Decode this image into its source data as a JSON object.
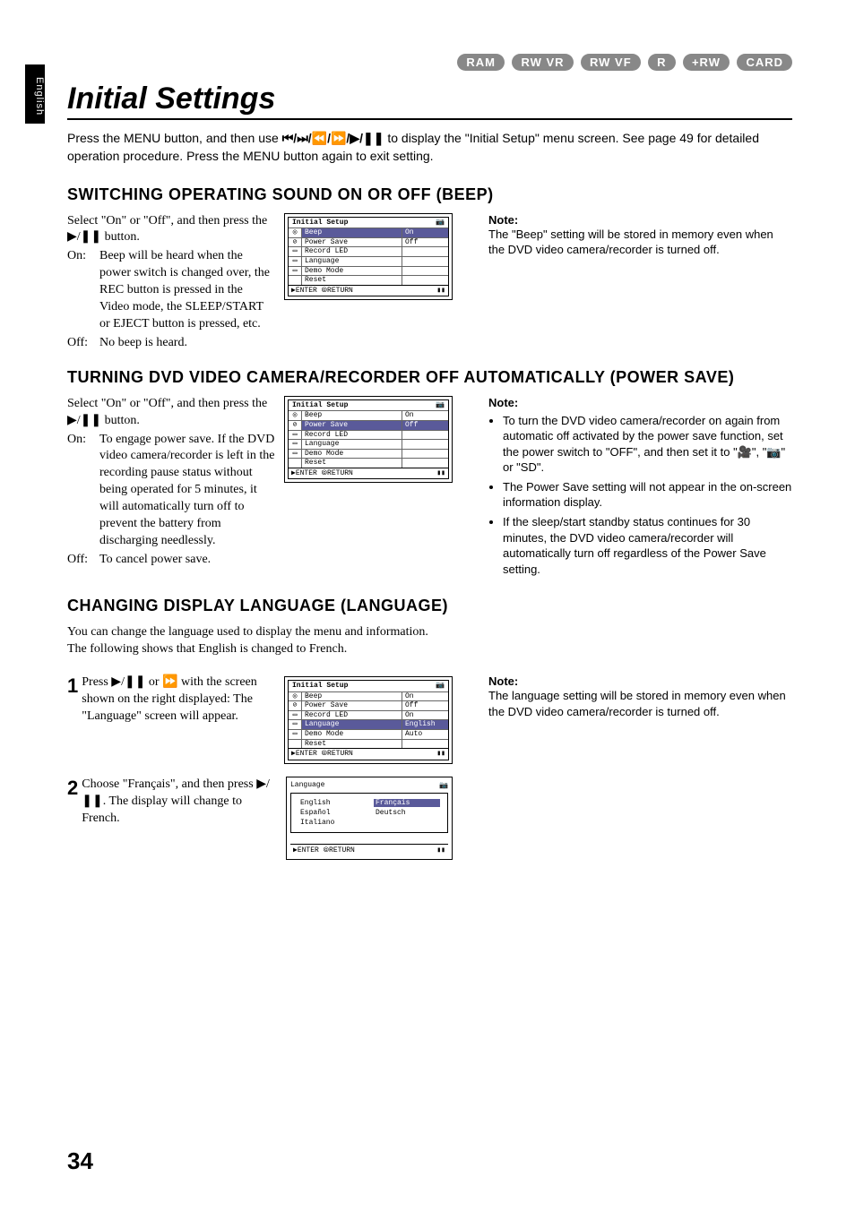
{
  "side_tab": "English",
  "badges": [
    "RAM",
    "RW VR",
    "RW VF",
    "R",
    "+RW",
    "CARD"
  ],
  "title": "Initial Settings",
  "intro_a": "Press the MENU button, and then use ",
  "intro_glyphs": "⏮/⏭/⏪/⏩/▶/❚❚",
  "intro_b": " to display the \"Initial Setup\" menu screen. See page 49 for detailed operation procedure. Press the MENU button again to exit setting.",
  "beep": {
    "heading": "SWITCHING OPERATING SOUND ON OR OFF (BEEP)",
    "select_line": "Select \"On\" or \"Off\", and then press the ▶/❚❚ button.",
    "on_label": "On:",
    "on_text": "Beep will be heard when the power switch is changed over, the REC button is pressed in the Video mode, the SLEEP/START or EJECT button is pressed, etc.",
    "off_label": "Off:",
    "off_text": "No beep is heard.",
    "note_head": "Note:",
    "note_text": "The \"Beep\" setting will be stored in memory even when the DVD video camera/recorder is turned off.",
    "osd": {
      "title": "Initial Setup",
      "rows": [
        {
          "label": "Beep",
          "val": "On",
          "hl": true,
          "valsel": true
        },
        {
          "label": "Power Save",
          "val": "Off"
        },
        {
          "label": "Record LED",
          "val": ""
        },
        {
          "label": "Language",
          "val": ""
        },
        {
          "label": "Demo Mode",
          "val": ""
        },
        {
          "label": "Reset",
          "val": ""
        }
      ],
      "foot_left": "ENTER",
      "foot_mid": "RETURN"
    }
  },
  "psave": {
    "heading": "TURNING DVD VIDEO CAMERA/RECORDER OFF AUTOMATICALLY (POWER SAVE)",
    "select_line": "Select \"On\" or \"Off\", and then press the ▶/❚❚ button.",
    "on_label": "On:",
    "on_text": "To engage power save. If the DVD video camera/recorder is left in the recording pause status without being operated for 5 minutes, it will automatically turn off to prevent the battery from discharging needlessly.",
    "off_label": "Off:",
    "off_text": "To cancel power save.",
    "note_head": "Note:",
    "notes": [
      "To turn the DVD video camera/recorder on again from automatic off activated by the power save function, set the power switch to \"OFF\", and then set it to \"🎥\", \"📷\" or \"SD\".",
      "The Power Save setting will not appear in the on-screen information display.",
      "If the sleep/start standby status continues for 30 minutes, the DVD video camera/recorder will automatically turn off regardless of the Power Save setting."
    ],
    "osd": {
      "title": "Initial Setup",
      "rows": [
        {
          "label": "Beep",
          "val": "On"
        },
        {
          "label": "Power Save",
          "val": "Off",
          "hl": true,
          "valsel": true
        },
        {
          "label": "Record LED",
          "val": ""
        },
        {
          "label": "Language",
          "val": ""
        },
        {
          "label": "Demo Mode",
          "val": ""
        },
        {
          "label": "Reset",
          "val": ""
        }
      ],
      "foot_left": "ENTER",
      "foot_mid": "RETURN"
    }
  },
  "lang": {
    "heading": "CHANGING DISPLAY LANGUAGE (LANGUAGE)",
    "intro": "You can change the language used to display the menu and information.\nThe following shows that English is changed to French.",
    "step1_num": "1",
    "step1_text": "Press ▶/❚❚ or ⏩ with the screen shown on the right displayed: The \"Language\" screen will appear.",
    "step2_num": "2",
    "step2_text": "Choose \"Français\", and then press ▶/❚❚. The display will change to French.",
    "note_head": "Note:",
    "note_text": "The language setting will be stored in memory even when the DVD video camera/recorder is turned off.",
    "osd1": {
      "title": "Initial Setup",
      "rows": [
        {
          "label": "Beep",
          "val": "On"
        },
        {
          "label": "Power Save",
          "val": "Off"
        },
        {
          "label": "Record LED",
          "val": "On"
        },
        {
          "label": "Language",
          "val": "English",
          "hl": true
        },
        {
          "label": "Demo Mode",
          "val": "Auto"
        },
        {
          "label": "Reset",
          "val": ""
        }
      ],
      "foot_left": "ENTER",
      "foot_mid": "RETURN"
    },
    "osd2": {
      "title": "Language",
      "items": [
        "English",
        "Français",
        "Español",
        "Deutsch",
        "Italiano"
      ],
      "sel": "Français",
      "foot_left": "ENTER",
      "foot_mid": "RETURN"
    }
  },
  "page_number": "34"
}
